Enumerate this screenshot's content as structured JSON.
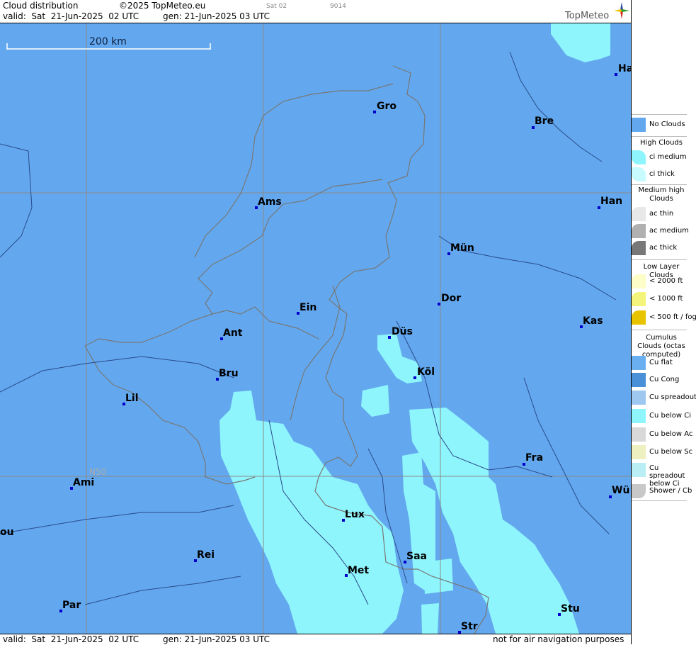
{
  "header": {
    "product": "Cloud distribution",
    "copyright": "©2025 TopMeteo.eu",
    "run": "Sat 02",
    "code": "9014",
    "valid": "valid:  Sat  21-Jun-2025  02 UTC",
    "generated": "gen: 21-Jun-2025 03 UTC",
    "logo": "TopMeteo"
  },
  "footer": {
    "valid": "valid:  Sat  21-Jun-2025  02 UTC",
    "generated": "gen: 21-Jun-2025 03 UTC",
    "disclaimer": "not for air navigation purposes"
  },
  "map": {
    "scale_label": "200 km",
    "lat_label": "N50",
    "cities": [
      {
        "label": "Gro"
      },
      {
        "label": "Bre"
      },
      {
        "label": "Ha"
      },
      {
        "label": "Ams"
      },
      {
        "label": "Han"
      },
      {
        "label": "Mün"
      },
      {
        "label": "Ein"
      },
      {
        "label": "Dor"
      },
      {
        "label": "Ant"
      },
      {
        "label": "Düs"
      },
      {
        "label": "Kas"
      },
      {
        "label": "Bru"
      },
      {
        "label": "Köl"
      },
      {
        "label": "Lil"
      },
      {
        "label": "Fra"
      },
      {
        "label": "Ami"
      },
      {
        "label": "Wü"
      },
      {
        "label": "Lux"
      },
      {
        "label": "ou"
      },
      {
        "label": "Rei"
      },
      {
        "label": "Saa"
      },
      {
        "label": "Met"
      },
      {
        "label": "Par"
      },
      {
        "label": "Stu"
      },
      {
        "label": "Str"
      }
    ],
    "colors": {
      "no_clouds": "#63a8ee",
      "ci_medium": "#8ff5fc",
      "ci_thick": "#b4f8fc"
    }
  },
  "legend": {
    "sections": [
      {
        "title": "",
        "items": [
          {
            "label": "No Clouds",
            "color": "#63a8ee"
          }
        ]
      },
      {
        "title": "High Clouds",
        "items": [
          {
            "label": "ci medium",
            "color": "#8ff5fc"
          },
          {
            "label": "ci thick",
            "color": "#c8fbfd"
          }
        ]
      },
      {
        "title": "Medium high Clouds",
        "items": [
          {
            "label": "ac thin",
            "color": "#e8e8e8"
          },
          {
            "label": "ac medium",
            "color": "#b0b0b0"
          },
          {
            "label": "ac thick",
            "color": "#787878"
          }
        ]
      },
      {
        "title": "Low Layer Clouds",
        "items": [
          {
            "label": "< 2000 ft",
            "color": "#fdfdc8"
          },
          {
            "label": "< 1000 ft",
            "color": "#f4f47a"
          },
          {
            "label": "< 500 ft / fog",
            "color": "#e8c400"
          }
        ]
      },
      {
        "title": "Cumulus Clouds (octas computed)",
        "items": [
          {
            "label": "Cu flat",
            "color": "#6ab0f0"
          },
          {
            "label": "Cu Cong",
            "color": "#4a90d8"
          },
          {
            "label": "Cu spreadout",
            "color": "#9fc8f0"
          },
          {
            "label": "Cu below Ci",
            "color": "#8ff5fc"
          },
          {
            "label": "Cu below Ac",
            "color": "#d8d8d8"
          },
          {
            "label": "Cu below Sc",
            "color": "#eef0c0"
          },
          {
            "label": "Cu spreadout below Ci",
            "color": "#b8eef4"
          },
          {
            "label": "Shower / Cb",
            "color": "#c8c8c8"
          }
        ]
      }
    ]
  }
}
